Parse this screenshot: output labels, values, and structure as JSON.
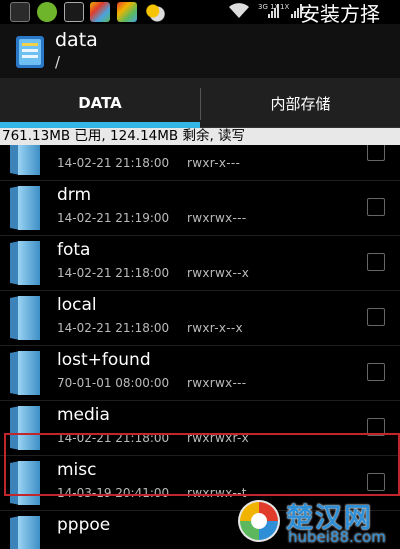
{
  "status_bar": {
    "icons": [
      "notification-icon",
      "360-security-icon",
      "gallery-icon",
      "app-store-icon",
      "app-store-icon-2",
      "weather-icon"
    ],
    "signal": [
      "3G 1X",
      "1X"
    ],
    "wifi_icon": "wifi-icon",
    "clock": "安装方择"
  },
  "app_bar": {
    "icon": "folder-app-icon",
    "title": "data",
    "path": "/"
  },
  "tabs": [
    {
      "label": "DATA",
      "active": true
    },
    {
      "label": "内部存储",
      "active": false
    }
  ],
  "storage_info": "761.13MB 已用, 124.14MB 剩余, 读写",
  "files": [
    {
      "name": "",
      "date": "14-02-21 21:18:00",
      "perm": "rwxr-x---",
      "checked": false
    },
    {
      "name": "drm",
      "date": "14-02-21 21:19:00",
      "perm": "rwxrwx---",
      "checked": false
    },
    {
      "name": "fota",
      "date": "14-02-21 21:18:00",
      "perm": "rwxrwx--x",
      "checked": false
    },
    {
      "name": "local",
      "date": "14-02-21 21:18:00",
      "perm": "rwxr-x--x",
      "checked": false
    },
    {
      "name": "lost+found",
      "date": "70-01-01 08:00:00",
      "perm": "rwxrwx---",
      "checked": false
    },
    {
      "name": "media",
      "date": "14-02-21 21:18:00",
      "perm": "rwxrwxr-x",
      "checked": false
    },
    {
      "name": "misc",
      "date": "14-03-19 20:41:00",
      "perm": "rwxrwx--t",
      "checked": false,
      "highlighted": true
    },
    {
      "name": "pppoe",
      "date": "",
      "perm": "",
      "checked": false
    }
  ],
  "watermark": {
    "title": "楚汉网",
    "url": "hubei88.com"
  },
  "colors": {
    "accent": "#33b5e5",
    "highlight_border": "#c0262b",
    "storage_bar_bg": "#e8e8e8"
  }
}
